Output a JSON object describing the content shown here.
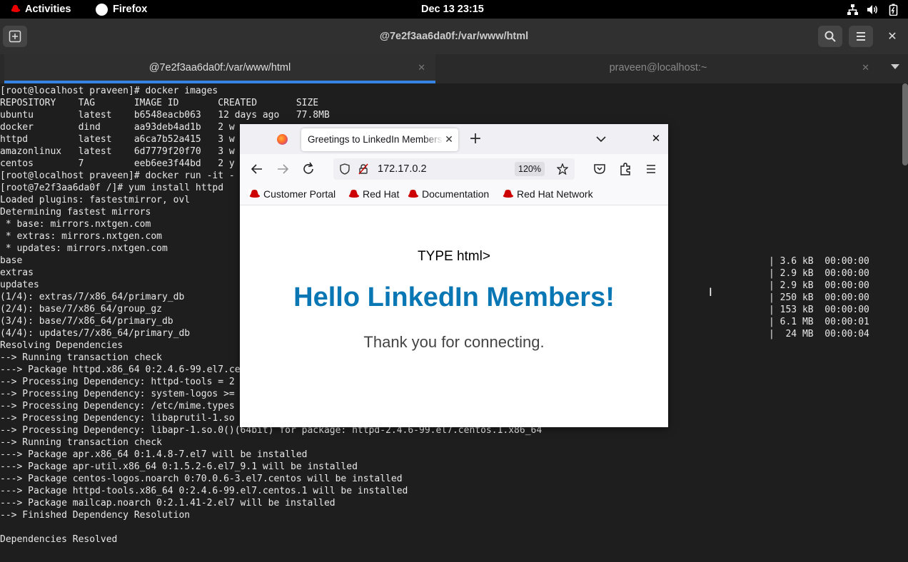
{
  "topbar": {
    "activities": "Activities",
    "app_name": "Firefox",
    "clock": "Dec 13  23:15"
  },
  "terminal": {
    "title": "@7e2f3aa6da0f:/var/www/html",
    "tabs": [
      {
        "label": "@7e2f3aa6da0f:/var/www/html",
        "active": true
      },
      {
        "label": "praveen@localhost:~",
        "active": false
      }
    ],
    "lines": [
      "[root@localhost praveen]# docker images",
      "REPOSITORY    TAG       IMAGE ID       CREATED       SIZE",
      "ubuntu        latest    b6548eacb063   12 days ago   77.8MB",
      "docker        dind      aa93deb4ad1b   2 w",
      "httpd         latest    a6ca7b52a415   3 w",
      "amazonlinux   latest    6d7779f20f70   3 w",
      "centos        7         eeb6ee3f44bd   2 y",
      "[root@localhost praveen]# docker run -it -",
      "[root@7e2f3aa6da0f /]# yum install httpd",
      "Loaded plugins: fastestmirror, ovl",
      "Determining fastest mirrors",
      " * base: mirrors.nxtgen.com",
      " * extras: mirrors.nxtgen.com",
      " * updates: mirrors.nxtgen.com",
      "base",
      "extras",
      "updates",
      "(1/4): extras/7/x86_64/primary_db",
      "(2/4): base/7/x86_64/group_gz",
      "(3/4): base/7/x86_64/primary_db",
      "(4/4): updates/7/x86_64/primary_db",
      "Resolving Dependencies",
      "--> Running transaction check",
      "---> Package httpd.x86_64 0:2.4.6-99.el7.ce",
      "--> Processing Dependency: httpd-tools = 2",
      "--> Processing Dependency: system-logos >=",
      "--> Processing Dependency: /etc/mime.types",
      "--> Processing Dependency: libaprutil-1.so",
      "--> Processing Dependency: libapr-1.so.0()(64bit) for package: httpd-2.4.6-99.el7.centos.1.x86_64",
      "--> Running transaction check",
      "---> Package apr.x86_64 0:1.4.8-7.el7 will be installed",
      "---> Package apr-util.x86_64 0:1.5.2-6.el7_9.1 will be installed",
      "---> Package centos-logos.noarch 0:70.0.6-3.el7.centos will be installed",
      "---> Package httpd-tools.x86_64 0:2.4.6-99.el7.centos.1 will be installed",
      "---> Package mailcap.noarch 0:2.1.41-2.el7 will be installed",
      "--> Finished Dependency Resolution",
      "",
      "Dependencies Resolved"
    ],
    "download_stats": [
      "| 3.6 kB  00:00:00",
      "| 2.9 kB  00:00:00",
      "| 2.9 kB  00:00:00",
      "| 250 kB  00:00:00",
      "| 153 kB  00:00:00",
      "| 6.1 MB  00:00:01",
      "|  24 MB  00:00:04"
    ]
  },
  "firefox": {
    "tab_title": "Greetings to LinkedIn Members",
    "url": "172.17.0.2",
    "zoom": "120%",
    "bookmarks": [
      "Customer Portal",
      "Red Hat",
      "Documentation",
      "Red Hat Network"
    ],
    "page": {
      "doctype_text": "TYPE html>",
      "heading": "Hello LinkedIn Members!",
      "text": "Thank you for connecting."
    }
  },
  "colors": {
    "heading": "#0a77b5",
    "accent": "#3584e4",
    "redhat": "#cc0000"
  }
}
